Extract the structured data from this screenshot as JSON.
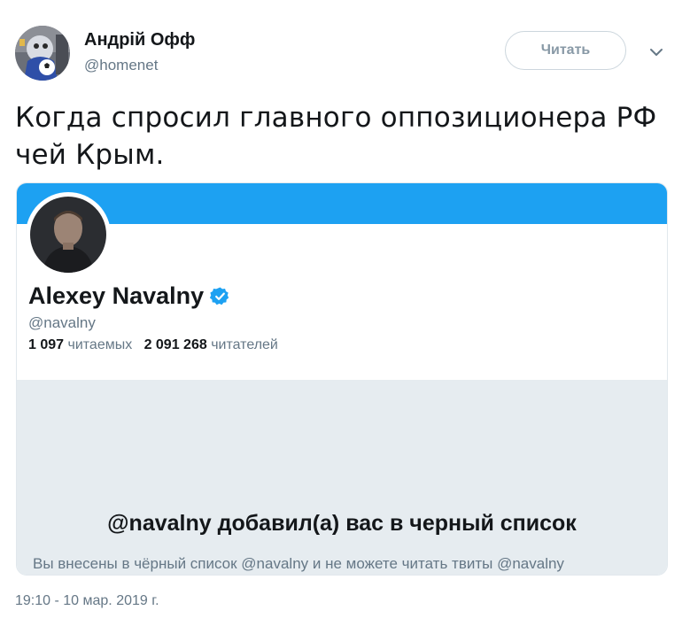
{
  "tweet": {
    "author_name": "Андрій Офф",
    "author_handle": "@homenet",
    "follow_label": "Читать",
    "text": "Когда спросил главного оппозиционера РФ чей Крым.",
    "timestamp": "19:10 - 10 мар. 2019 г."
  },
  "embedded_profile": {
    "name": "Alexey Navalny",
    "handle": "@navalny",
    "following_count": "1 097",
    "following_label": "читаемых",
    "followers_count": "2 091 268",
    "followers_label": "читателей",
    "blocked_title": "@navalny добавил(а) вас в черный список",
    "blocked_desc": "Вы внесены в чёрный список @navalny и не можете читать твиты @navalny"
  },
  "icons": {
    "caret": "chevron-down-icon",
    "verified": "verified-badge-icon"
  },
  "colors": {
    "banner": "#1da1f2",
    "verified": "#1da1f2",
    "blocked_bg": "#e6ecf0",
    "secondary_text": "#657786"
  }
}
